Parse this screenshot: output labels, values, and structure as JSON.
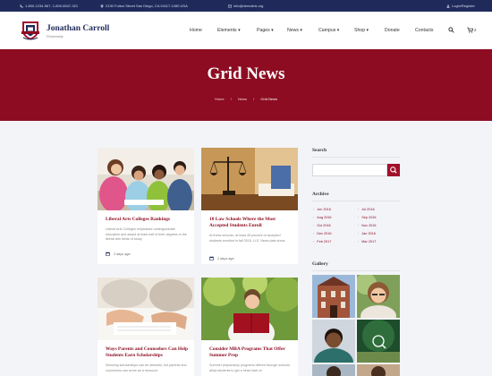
{
  "topbar": {
    "phone": "1-800-1234-567, 1-800-6547-321",
    "address": "2130 Fulton Street San Diego, CA 94117-1080 USA",
    "email": "info@demolink.org",
    "login": "Login/Register"
  },
  "header": {
    "brand_name": "Jonathan Carroll",
    "brand_sub": "University",
    "nav": [
      "Home",
      "Elements ▾",
      "Pages ▾",
      "News ▾",
      "Campus ▾",
      "Shop ▾",
      "Donate",
      "Contacts"
    ],
    "cart_count": "2"
  },
  "hero": {
    "title": "Grid News",
    "breadcrumb": [
      "Home",
      "News",
      "Grid News"
    ],
    "separator": "/"
  },
  "posts": [
    {
      "title": "Liberal Arts Colleges Rankings",
      "excerpt": "Liberal Arts Colleges emphasize undergraduate education and award at least half of their degrees in the liberal arts fields of study.",
      "date": "2 days ago"
    },
    {
      "title": "10 Law Schools Where the Most Accepted Students Enroll",
      "excerpt": "At these schools, at least 45 percent of accepted students enrolled in fall 2015, U.S. News data show.",
      "date": "2 days ago"
    },
    {
      "title": "Ways Parents and Counselors Can Help Students Earn Scholarships",
      "excerpt": "Securing scholarships can be stressful, but parents and counselors can serve as a resource.",
      "date": ""
    },
    {
      "title": "Consider MBA Programs That Offer Summer Prep",
      "excerpt": "Summer preparatory programs offered through schools allow students to get a head start on",
      "date": ""
    }
  ],
  "sidebar": {
    "search_heading": "Search",
    "archive_heading": "Archive",
    "archive_left": [
      "Jun 2016",
      "Aug 2016",
      "Oct 2016",
      "Dec 2016",
      "Feb 2017"
    ],
    "archive_right": [
      "Jul 2016",
      "Sep 2016",
      "Nov 2016",
      "Jan 2016",
      "Mar 2017"
    ],
    "gallery_heading": "Gallery"
  },
  "colors": {
    "navy": "#1f2a5b",
    "crimson": "#8d0c22",
    "background": "#f3f4f8"
  }
}
